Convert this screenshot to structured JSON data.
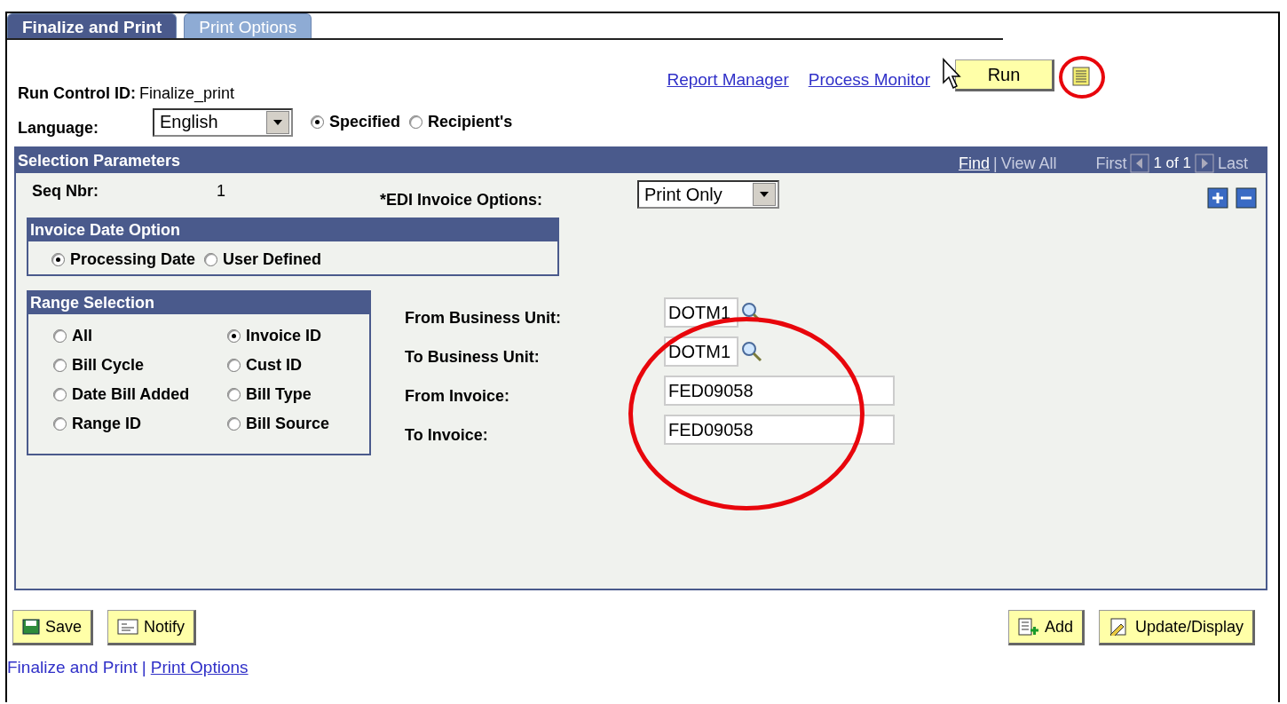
{
  "tabs": [
    {
      "label": "Finalize and Print",
      "selected": true
    },
    {
      "label": "Print Options",
      "selected": false
    }
  ],
  "links": [
    "Report Manager",
    "Process Monitor"
  ],
  "run_button": {
    "label": "Run"
  },
  "report_icon": {
    "circled": true
  },
  "run_control": {
    "label": "Run Control ID:",
    "value": "Finalize_print"
  },
  "language": {
    "label": "Language:",
    "value": "English",
    "options": [
      {
        "label": "Specified",
        "selected": true
      },
      {
        "label": "Recipient's",
        "selected": false
      }
    ]
  },
  "selection": {
    "title": "Selection Parameters",
    "nav": {
      "find": "Find",
      "separator": "|",
      "view_all": "View All",
      "first": "First",
      "count": "1 of 1",
      "last": "Last"
    },
    "seq": {
      "label": "Seq Nbr:",
      "value": "1"
    },
    "edi": {
      "label": "*EDI Invoice Options:",
      "value": "Print Only"
    },
    "date_option": {
      "title": "Invoice Date Option",
      "options": [
        {
          "label": "Processing Date",
          "selected": true
        },
        {
          "label": "User Defined",
          "selected": false
        }
      ]
    },
    "range": {
      "title": "Range Selection",
      "options": [
        {
          "label": "All",
          "selected": false
        },
        {
          "label": "Invoice ID",
          "selected": true
        },
        {
          "label": "Bill Cycle",
          "selected": false
        },
        {
          "label": "Cust ID",
          "selected": false
        },
        {
          "label": "Date Bill Added",
          "selected": false
        },
        {
          "label": "Bill Type",
          "selected": false
        },
        {
          "label": "Range ID",
          "selected": false
        },
        {
          "label": "Bill Source",
          "selected": false
        }
      ]
    },
    "fields": [
      {
        "label": "From Business Unit:",
        "value": "DOTM1",
        "kind": "lookup"
      },
      {
        "label": "To Business Unit:",
        "value": "DOTM1",
        "kind": "lookup"
      },
      {
        "label": "From Invoice:",
        "value": "FED09058",
        "kind": "text"
      },
      {
        "label": "To Invoice:",
        "value": "FED09058",
        "kind": "text"
      }
    ],
    "fields_circled": true
  },
  "buttons_left": [
    {
      "label": "Save",
      "kind": "save"
    },
    {
      "label": "Notify",
      "kind": "notify"
    }
  ],
  "buttons_right": [
    {
      "label": "Add",
      "kind": "add"
    },
    {
      "label": "Update/Display",
      "kind": "update"
    }
  ],
  "footer": {
    "current": "Finalize and Print",
    "separator": "|",
    "link": "Print Options"
  }
}
